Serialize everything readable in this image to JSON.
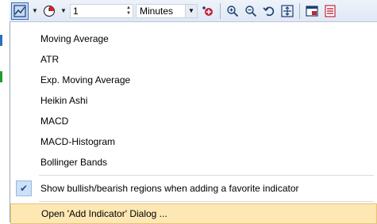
{
  "toolbar": {
    "interval_value": "1",
    "unit_value": "Minutes"
  },
  "menu": {
    "indicators": [
      "Moving Average",
      "ATR",
      "Exp. Moving Average",
      "Heikin Ashi",
      "MACD",
      "MACD-Histogram",
      "Bollinger Bands"
    ],
    "option_label": "Show bullish/bearish regions when adding a favorite indicator",
    "dialog_label": "Open 'Add Indicator' Dialog ..."
  },
  "colors": {
    "highlight": "#fde8b3",
    "accent": "#3d6fb4"
  }
}
